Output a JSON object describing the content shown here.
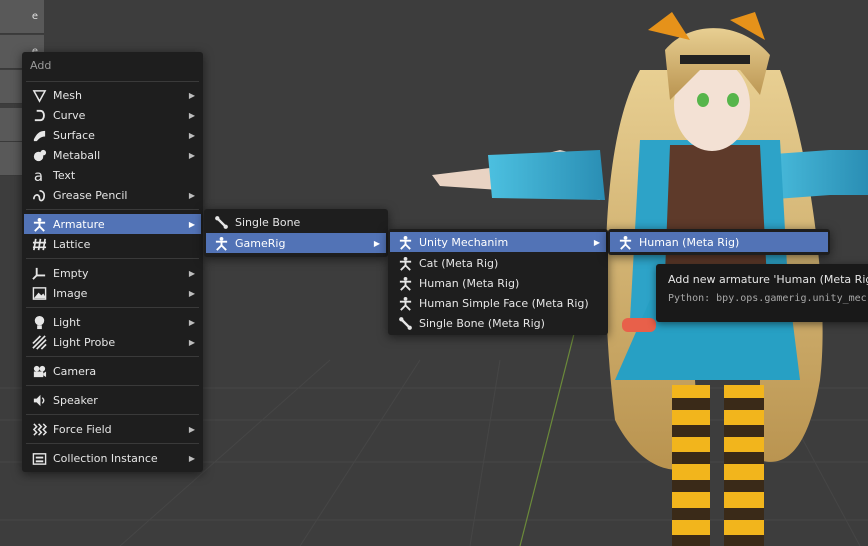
{
  "toolbar": {
    "labels": [
      "e",
      "e",
      "rm",
      "te",
      "re"
    ]
  },
  "add_menu": {
    "title": "Add",
    "items": [
      {
        "label": "Mesh",
        "icon": "mesh-icon",
        "submenu": true
      },
      {
        "label": "Curve",
        "icon": "curve-icon",
        "submenu": true
      },
      {
        "label": "Surface",
        "icon": "surface-icon",
        "submenu": true
      },
      {
        "label": "Metaball",
        "icon": "metaball-icon",
        "submenu": true
      },
      {
        "label": "Text",
        "icon": "text-icon",
        "submenu": false
      },
      {
        "label": "Grease Pencil",
        "icon": "grease-pencil-icon",
        "submenu": true
      },
      {
        "label": "Armature",
        "icon": "armature-icon",
        "submenu": true,
        "active": true
      },
      {
        "label": "Lattice",
        "icon": "lattice-icon",
        "submenu": false
      },
      {
        "label": "Empty",
        "icon": "empty-icon",
        "submenu": true
      },
      {
        "label": "Image",
        "icon": "image-icon",
        "submenu": true
      },
      {
        "label": "Light",
        "icon": "light-icon",
        "submenu": true
      },
      {
        "label": "Light Probe",
        "icon": "light-probe-icon",
        "submenu": true
      },
      {
        "label": "Camera",
        "icon": "camera-icon",
        "submenu": false
      },
      {
        "label": "Speaker",
        "icon": "speaker-icon",
        "submenu": false
      },
      {
        "label": "Force Field",
        "icon": "force-field-icon",
        "submenu": true
      },
      {
        "label": "Collection Instance",
        "icon": "collection-instance-icon",
        "submenu": true
      }
    ]
  },
  "armature_menu": {
    "items": [
      {
        "label": "Single Bone",
        "icon": "bone-icon",
        "submenu": false
      },
      {
        "label": "GameRig",
        "icon": "armature-icon",
        "submenu": true,
        "active": true
      }
    ]
  },
  "gamerig_menu": {
    "items": [
      {
        "label": "Unity Mechanim",
        "icon": "armature-icon",
        "submenu": true,
        "active": true
      },
      {
        "label": "Cat (Meta Rig)",
        "icon": "armature-icon",
        "submenu": false
      },
      {
        "label": "Human (Meta Rig)",
        "icon": "armature-icon",
        "submenu": false
      },
      {
        "label": "Human Simple Face (Meta Rig)",
        "icon": "armature-icon",
        "submenu": false
      },
      {
        "label": "Single Bone (Meta Rig)",
        "icon": "bone-icon",
        "submenu": false
      }
    ]
  },
  "unity_menu": {
    "items": [
      {
        "label": "Human (Meta Rig)",
        "icon": "armature-icon",
        "submenu": false,
        "active": true
      }
    ]
  },
  "tooltip": {
    "text": "Add new armature 'Human (Meta Rig)' t",
    "python": "Python: bpy.ops.gamerig.unity_mec"
  },
  "colors": {
    "highlight": "#5273b6",
    "menu_bg": "#1e1e1e",
    "viewport_bg": "#3d3d3d"
  }
}
